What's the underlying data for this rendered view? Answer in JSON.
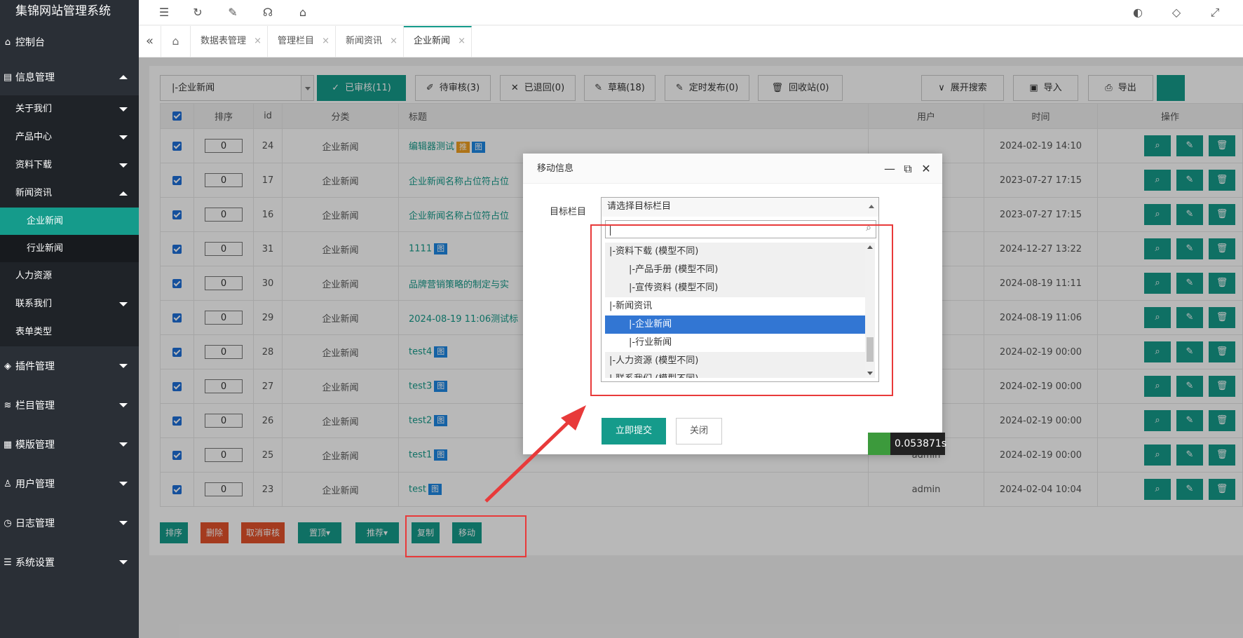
{
  "app": {
    "title": "集锦网站管理系统"
  },
  "sidebar": {
    "items": [
      {
        "label": "控制台",
        "icon": "home-icon"
      },
      {
        "label": "信息管理",
        "icon": "list-icon"
      },
      {
        "label": "插件管理",
        "icon": "cube-icon"
      },
      {
        "label": "栏目管理",
        "icon": "layers-icon"
      },
      {
        "label": "模版管理",
        "icon": "template-icon"
      },
      {
        "label": "用户管理",
        "icon": "user-icon"
      },
      {
        "label": "日志管理",
        "icon": "clock-icon"
      },
      {
        "label": "系统设置",
        "icon": "sliders-icon"
      }
    ],
    "sub": [
      {
        "label": "关于我们"
      },
      {
        "label": "产品中心"
      },
      {
        "label": "资料下载"
      },
      {
        "label": "新闻资讯"
      },
      {
        "label": "人力资源"
      },
      {
        "label": "联系我们"
      },
      {
        "label": "表单类型"
      }
    ],
    "subsub": [
      {
        "label": "企业新闻"
      },
      {
        "label": "行业新闻"
      }
    ]
  },
  "tabs": [
    "数据表管理",
    "管理栏目",
    "新闻资讯",
    "企业新闻"
  ],
  "filter": {
    "category": "|-企业新闻",
    "approved": "已审核(11)",
    "pending": "待审核(3)",
    "returned": "已退回(0)",
    "draft": "草稿(18)",
    "scheduled": "定时发布(0)",
    "recycle": "回收站(0)",
    "expand_search": "展开搜索",
    "import": "导入",
    "export": "导出"
  },
  "table": {
    "headers": [
      "排序",
      "id",
      "分类",
      "标题",
      "用户",
      "时间",
      "操作"
    ],
    "rows": [
      {
        "sort": "0",
        "id": "24",
        "cat": "企业新闻",
        "title": "编辑器测试",
        "tags": [
          "推",
          "图"
        ],
        "user": "",
        "time": "2024-02-19 14:10"
      },
      {
        "sort": "0",
        "id": "17",
        "cat": "企业新闻",
        "title": "企业新闻名称占位符占位",
        "tags": [],
        "user": "",
        "time": "2023-07-27 17:15"
      },
      {
        "sort": "0",
        "id": "16",
        "cat": "企业新闻",
        "title": "企业新闻名称占位符占位",
        "tags": [],
        "user": "",
        "time": "2023-07-27 17:15"
      },
      {
        "sort": "0",
        "id": "31",
        "cat": "企业新闻",
        "title": "1111",
        "tags": [
          "图"
        ],
        "user": "",
        "time": "2024-12-27 13:22"
      },
      {
        "sort": "0",
        "id": "30",
        "cat": "企业新闻",
        "title": "品牌营销策略的制定与实",
        "tags": [],
        "user": "",
        "time": "2024-08-19 11:11"
      },
      {
        "sort": "0",
        "id": "29",
        "cat": "企业新闻",
        "title": "2024-08-19 11:06测试标",
        "tags": [],
        "user": "",
        "time": "2024-08-19 11:06"
      },
      {
        "sort": "0",
        "id": "28",
        "cat": "企业新闻",
        "title": "test4",
        "tags": [
          "图"
        ],
        "user": "",
        "time": "2024-02-19 00:00"
      },
      {
        "sort": "0",
        "id": "27",
        "cat": "企业新闻",
        "title": "test3",
        "tags": [
          "图"
        ],
        "user": "",
        "time": "2024-02-19 00:00"
      },
      {
        "sort": "0",
        "id": "26",
        "cat": "企业新闻",
        "title": "test2",
        "tags": [
          "图"
        ],
        "user": "",
        "time": "2024-02-19 00:00"
      },
      {
        "sort": "0",
        "id": "25",
        "cat": "企业新闻",
        "title": "test1",
        "tags": [
          "图"
        ],
        "user": "admin",
        "time": "2024-02-19 00:00"
      },
      {
        "sort": "0",
        "id": "23",
        "cat": "企业新闻",
        "title": "test",
        "tags": [
          "图"
        ],
        "user": "admin",
        "time": "2024-02-04 10:04"
      }
    ]
  },
  "actions": {
    "sort": "排序",
    "delete": "删除",
    "cancel_review": "取消审核",
    "pin": "置顶",
    "recommend": "推荐",
    "copy": "复制",
    "move": "移动"
  },
  "dialog": {
    "title": "移动信息",
    "label": "目标栏目",
    "placeholder": "请选择目标栏目",
    "options": [
      {
        "label": "|-资料下载 (模型不同)",
        "level": 1,
        "state": "grey"
      },
      {
        "label": "|-产品手册 (模型不同)",
        "level": 2,
        "state": "grey"
      },
      {
        "label": "|-宣传资料 (模型不同)",
        "level": 2,
        "state": "grey"
      },
      {
        "label": "|-新闻资讯",
        "level": 1,
        "state": "normal"
      },
      {
        "label": "|-企业新闻",
        "level": 2,
        "state": "selected"
      },
      {
        "label": "|-行业新闻",
        "level": 2,
        "state": "normal"
      },
      {
        "label": "|-人力资源 (模型不同)",
        "level": 1,
        "state": "grey"
      },
      {
        "label": "|-联系我们 (模型不同)",
        "level": 1,
        "state": "grey"
      }
    ],
    "submit": "立即提交",
    "close": "关闭"
  },
  "timer": "0.053871s",
  "colors": {
    "accent": "#159b8b",
    "danger": "#e4532c",
    "highlight": "#e83a3a",
    "selected": "#3276d3"
  }
}
